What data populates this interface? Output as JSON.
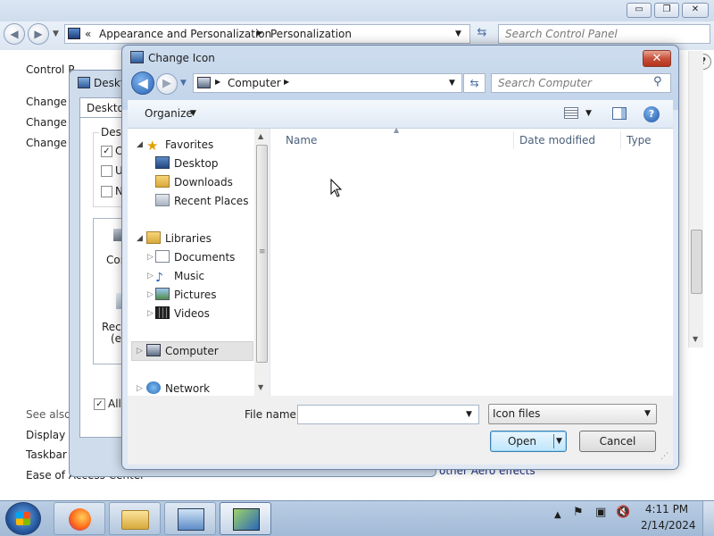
{
  "control_panel": {
    "address": {
      "prefix": "«",
      "crumbs": [
        "Appearance and Personalization",
        "Personalization"
      ]
    },
    "search_placeholder": "Search Control Panel",
    "caption_buttons": [
      "▭",
      "❐",
      "✕"
    ],
    "left_title": "Control P",
    "left_links": [
      "Change d",
      "Change m",
      "Change y"
    ],
    "see_also_label": "See also",
    "see_also_links": [
      "Display",
      "Taskbar a",
      "Ease of Access Center"
    ],
    "partial_link": "other Aero effects"
  },
  "desktop_icon_settings": {
    "title": "Deskt",
    "tab": "Desktop",
    "group_label": "Desk",
    "checkboxes": [
      {
        "label": "C",
        "checked": true
      },
      {
        "label": "U",
        "checked": false
      },
      {
        "label": "N",
        "checked": false
      }
    ],
    "icon_labels": [
      "Con",
      "Recy",
      "(en"
    ],
    "allow_label": "Allo",
    "allow_checked": true
  },
  "dialog": {
    "title": "Change Icon",
    "close_glyph": "✕",
    "address": {
      "crumbs": [
        "Computer"
      ]
    },
    "search_placeholder": "Search Computer",
    "toolbar": {
      "organize_label": "Organize",
      "help_glyph": "?"
    },
    "nav_tree": [
      {
        "label": "Favorites",
        "level": 0,
        "icon": "star-icon",
        "expanded": true
      },
      {
        "label": "Desktop",
        "level": 1,
        "icon": "desktop-icon"
      },
      {
        "label": "Downloads",
        "level": 1,
        "icon": "downloads-folder-icon"
      },
      {
        "label": "Recent Places",
        "level": 1,
        "icon": "recent-places-icon"
      },
      {
        "label": "Libraries",
        "level": 0,
        "icon": "libraries-icon",
        "expanded": true
      },
      {
        "label": "Documents",
        "level": 1,
        "icon": "documents-icon"
      },
      {
        "label": "Music",
        "level": 1,
        "icon": "music-icon"
      },
      {
        "label": "Pictures",
        "level": 1,
        "icon": "pictures-icon"
      },
      {
        "label": "Videos",
        "level": 1,
        "icon": "videos-icon"
      },
      {
        "label": "Computer",
        "level": 0,
        "icon": "computer-icon",
        "selected": true
      },
      {
        "label": "Network",
        "level": 0,
        "icon": "network-icon"
      }
    ],
    "columns": [
      "Name",
      "Date modified",
      "Type"
    ],
    "file_name_label": "File name:",
    "file_name_value": "",
    "file_type_value": "Icon files",
    "open_label": "Open",
    "cancel_label": "Cancel"
  },
  "taskbar": {
    "apps": [
      "firefox-icon",
      "explorer-icon",
      "control-panel-icon",
      "personalization-icon"
    ],
    "clock_time": "4:11 PM",
    "clock_date": "2/14/2024"
  },
  "colors": {
    "accent": "#2a64b4",
    "link": "#1e3287",
    "close_red": "#c8503a"
  }
}
